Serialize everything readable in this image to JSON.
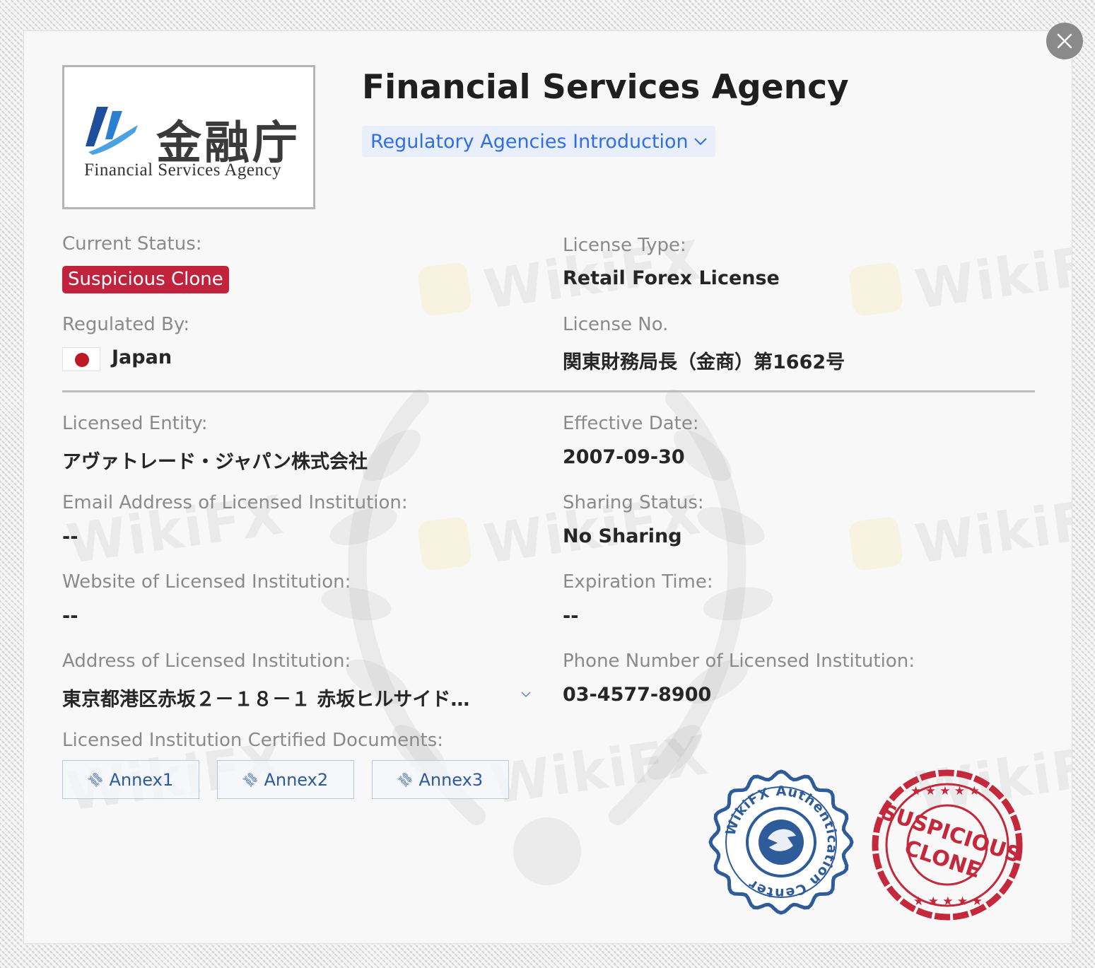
{
  "header": {
    "logo_kanji": "金融庁",
    "logo_subtitle": "Financial Services Agency",
    "title": "Financial Services Agency",
    "intro_link": "Regulatory Agencies Introduction"
  },
  "fields": {
    "current_status": {
      "label": "Current Status:",
      "value": "Suspicious Clone"
    },
    "license_type": {
      "label": "License Type:",
      "value": "Retail Forex License"
    },
    "regulated_by": {
      "label": "Regulated By:",
      "value": "Japan"
    },
    "license_no": {
      "label": "License No.",
      "value": "関東財務局長（金商）第1662号"
    },
    "licensed_entity": {
      "label": "Licensed Entity:",
      "value": "アヴァトレード・ジャパン株式会社"
    },
    "effective_date": {
      "label": "Effective Date:",
      "value": "2007-09-30"
    },
    "email": {
      "label": "Email Address of Licensed Institution:",
      "value": "--"
    },
    "sharing_status": {
      "label": "Sharing Status:",
      "value": "No Sharing"
    },
    "website": {
      "label": "Website of Licensed Institution:",
      "value": "--"
    },
    "expiration_time": {
      "label": "Expiration Time:",
      "value": "--"
    },
    "address": {
      "label": "Address of Licensed Institution:",
      "value": "東京都港区赤坂２－１８－１ 赤坂ヒルサイド…"
    },
    "phone": {
      "label": "Phone Number of Licensed Institution:",
      "value": "03-4577-8900"
    },
    "documents": {
      "label": "Licensed Institution Certified Documents:"
    }
  },
  "annexes": [
    "Annex1",
    "Annex2",
    "Annex3"
  ],
  "seals": {
    "blue_text": "WikiFX Authentication Center",
    "red_top": "SUSPICIOUS",
    "red_bottom": "CLONE"
  },
  "watermark": "WikiFX",
  "colors": {
    "status_red": "#c2233c",
    "link_blue": "#2f6fe3",
    "seal_blue": "#2e5b9a",
    "seal_red": "#c4283a"
  }
}
